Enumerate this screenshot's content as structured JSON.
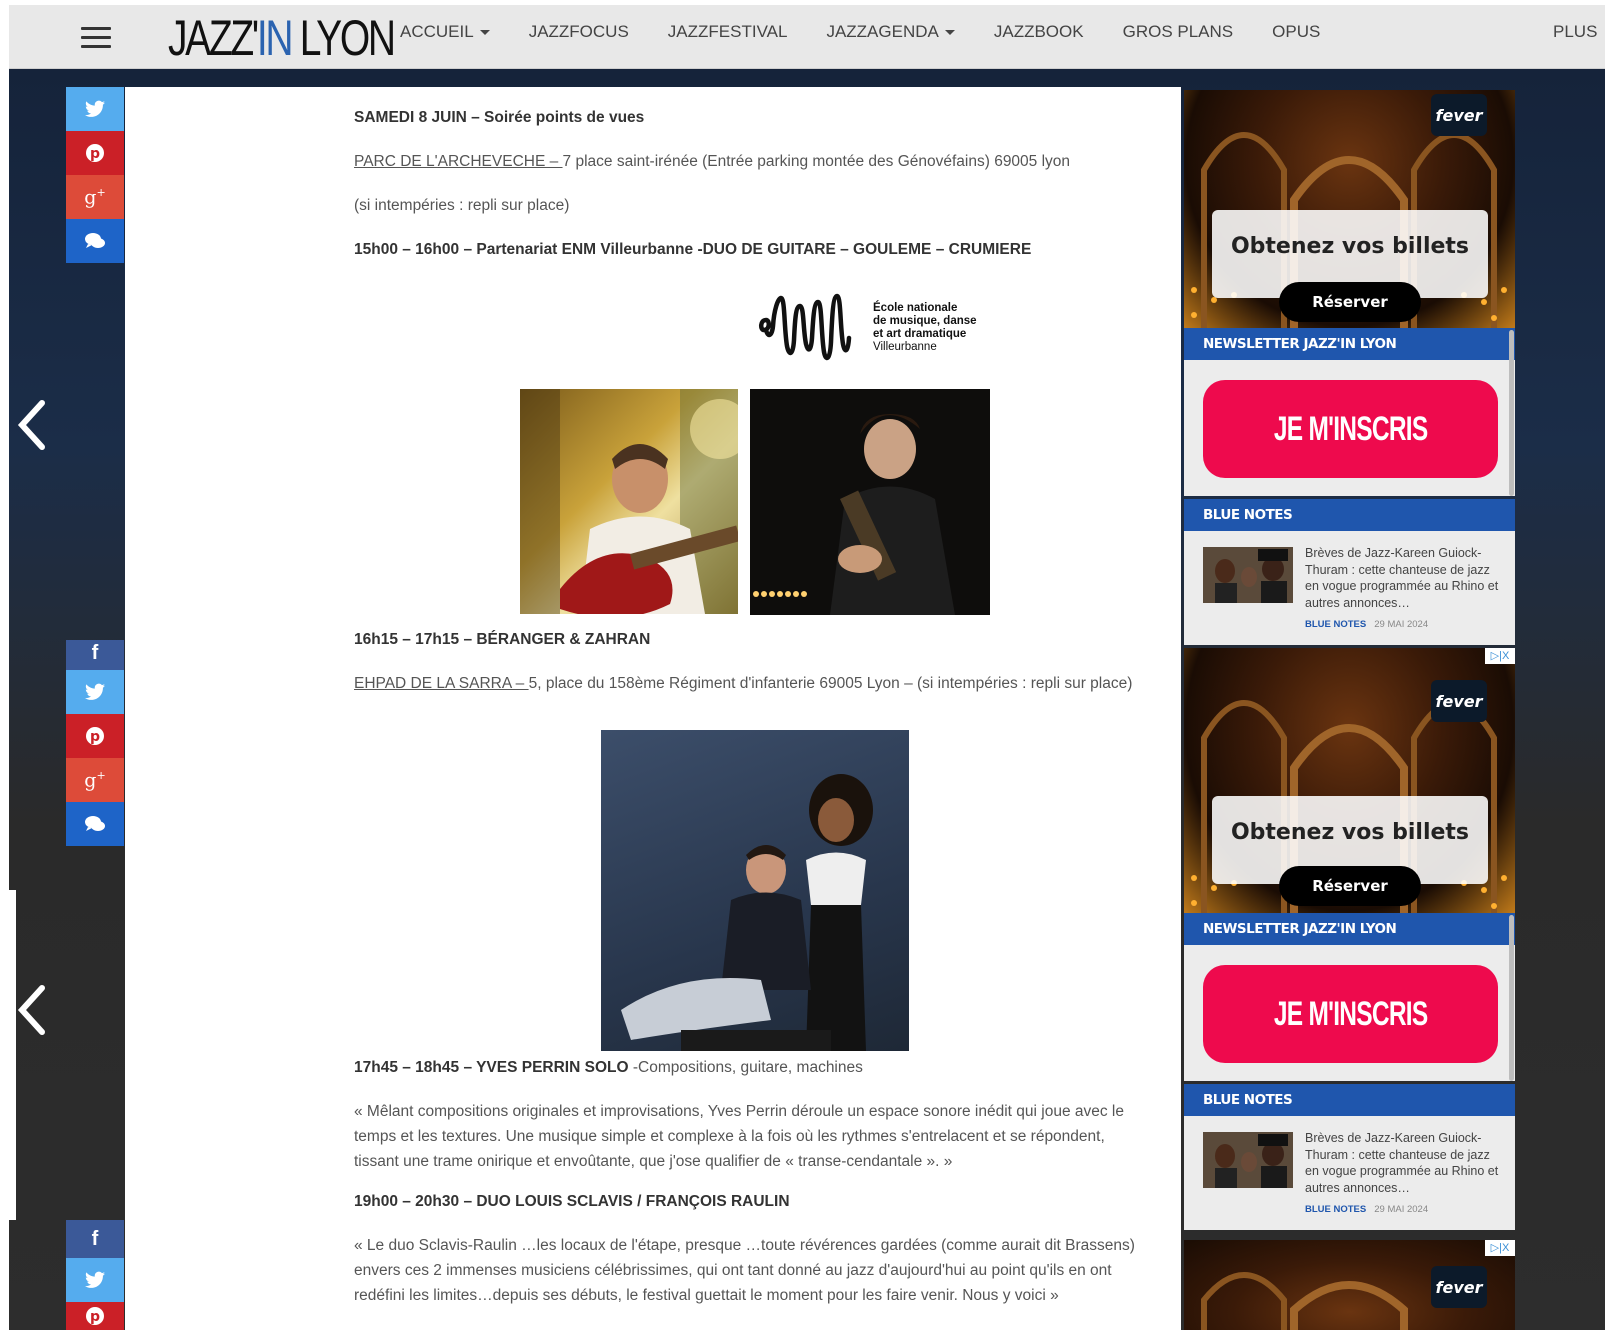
{
  "nav": {
    "logo_part1": "JAZZ'",
    "logo_part2": "IN",
    "logo_part3": " LYON",
    "items": [
      "ACCUEIL",
      "JAZZFOCUS",
      "JAZZFESTIVAL",
      "JAZZAGENDA",
      "JAZZBOOK",
      "GROS PLANS",
      "OPUS"
    ],
    "more": "PLUS"
  },
  "article": {
    "day_title": "SAMEDI 8 JUIN – Soirée points de vues",
    "venue1_link": "PARC DE L'ARCHEVECHE – ",
    "venue1_addr": "7 place saint-irénée (Entrée parking montée des Génovéfains) 69005 lyon",
    "venue1_note": "(si intempéries : repli sur place)",
    "slot1": "15h00 – 16h00 – Partenariat ENM Villeurbanne -DUO DE GUITARE – GOULEME – CRUMIERE",
    "enm_l1": "École nationale",
    "enm_l2": "de musique, danse",
    "enm_l3": "et art dramatique",
    "enm_l4": "Villeurbanne",
    "slot2": "16h15 – 17h15 – BÉRANGER & ZAHRAN",
    "venue2_link": "EHPAD DE LA SARRA – ",
    "venue2_addr": "5, place du 158ème Régiment d'infanterie 69005 Lyon – (si intempéries : repli sur place)",
    "slot3_bold": "17h45 – 18h45 – YVES PERRIN SOLO",
    "slot3_rest": " -Compositions, guitare, machines",
    "slot3_quote": "« Mêlant compositions originales et improvisations, Yves Perrin déroule un espace sonore inédit qui joue avec le temps et les textures. Une musique simple et complexe à la fois où les rythmes s'entrelacent et se répondent, tissant une trame onirique et envoûtante, que j'ose qualifier de « transe-cendantale ». »",
    "slot4": "19h00 – 20h30 – DUO LOUIS SCLAVIS / FRANÇOIS RAULIN",
    "slot4_quote": "« Le duo Sclavis-Raulin …les locaux de l'étape, presque …toute révérences gardées (comme aurait dit Brassens) envers ces 2 immenses musiciens célébrissimes, qui ont tant donné au jazz d'aujourd'hui au point qu'ils en ont redéfini les limites…depuis ses débuts, le festival guettait le moment pour les faire venir. Nous y voici »"
  },
  "sidebar": {
    "ad_brand": "fever",
    "ad_title": "Obtenez vos billets",
    "ad_button": "Réserver",
    "newsletter_head": "NEWSLETTER JAZZ'IN LYON",
    "newsletter_button": "JE M'INSCRIS",
    "blue_head": "BLUE NOTES",
    "blue_text": "Brèves de Jazz-Kareen Guiock-Thuram : cette chanteuse de jazz en vogue programmée au Rhino et autres annonces…",
    "blue_cat": "BLUE NOTES",
    "blue_date": "29 MAI 2024",
    "adchoices": "▷|X"
  }
}
